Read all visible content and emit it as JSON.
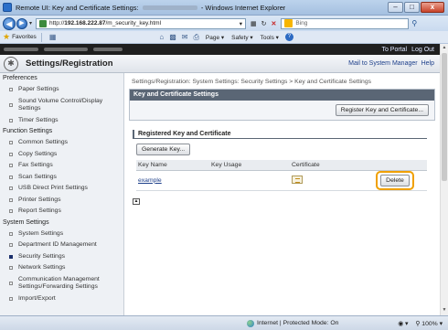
{
  "window": {
    "title_prefix": "Remote UI: Key and Certificate Settings:",
    "title_suffix": "- Windows Internet Explorer",
    "min_label": "–",
    "max_label": "□",
    "close_label": "x"
  },
  "address_bar": {
    "url_scheme": "http://",
    "url_host": "192.168.222.87",
    "url_path": "/m_security_key.html",
    "search_placeholder": "Bing"
  },
  "favorites_bar": {
    "favorites_label": "Favorites",
    "page_menu": "Page ▾",
    "safety_menu": "Safety ▾",
    "tools_menu": "Tools ▾"
  },
  "top_links": {
    "portal": "To Portal",
    "logout": "Log Out"
  },
  "header": {
    "title": "Settings/Registration",
    "mail_link": "Mail to System Manager",
    "help_link": "Help"
  },
  "sidebar": {
    "preferences_heading": "Preferences",
    "preferences": [
      {
        "label": "Paper Settings"
      },
      {
        "label": "Sound Volume Control/Display Settings"
      },
      {
        "label": "Timer Settings"
      }
    ],
    "function_heading": "Function Settings",
    "functions": [
      {
        "label": "Common Settings"
      },
      {
        "label": "Copy Settings"
      },
      {
        "label": "Fax Settings"
      },
      {
        "label": "Scan Settings"
      },
      {
        "label": "USB Direct Print Settings"
      },
      {
        "label": "Printer Settings"
      },
      {
        "label": "Report Settings"
      }
    ],
    "system_heading": "System Settings",
    "system": [
      {
        "label": "System Settings"
      },
      {
        "label": "Department ID Management"
      },
      {
        "label": "Security Settings"
      },
      {
        "label": "Network Settings"
      },
      {
        "label": "Communication Management Settings/Forwarding Settings"
      },
      {
        "label": "Import/Export"
      }
    ]
  },
  "main": {
    "breadcrumb": "Settings/Registration: System Settings: Security Settings > Key and Certificate Settings",
    "panel_title": "Key and Certificate Settings",
    "register_button": "Register Key and Certificate...",
    "section_title": "Registered Key and Certificate",
    "generate_button": "Generate Key...",
    "table": {
      "headers": [
        "Key Name",
        "Key Usage",
        "Certificate",
        ""
      ],
      "rows": [
        {
          "key_name": "example",
          "key_usage": "",
          "delete_label": "Delete"
        }
      ]
    }
  },
  "status_bar": {
    "zone": "Internet | Protected Mode: On",
    "zoom": "100%"
  }
}
